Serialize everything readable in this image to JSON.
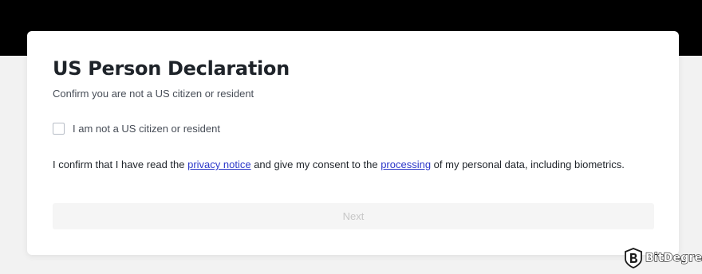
{
  "dialog": {
    "title": "US Person Declaration",
    "subtitle": "Confirm you are not a US citizen or resident",
    "checkbox_label": "I am not a US citizen or resident",
    "checkbox_checked": false,
    "consent": {
      "part1": "I confirm that I have read the ",
      "link1": "privacy notice",
      "part2": " and give my consent to the ",
      "link2": "processing",
      "part3": " of my personal data, including biometrics."
    },
    "next_label": "Next",
    "next_disabled": true
  },
  "watermark": {
    "logo_icon": "bitdegree-shield-icon",
    "text": "BitDegree"
  },
  "colors": {
    "header_band": "#000000",
    "page_background": "#f2f2f2",
    "link": "#2b37c9",
    "title_text": "#1e2329",
    "button_disabled_bg": "#f5f5f5",
    "button_disabled_text": "#c7c7c7"
  }
}
